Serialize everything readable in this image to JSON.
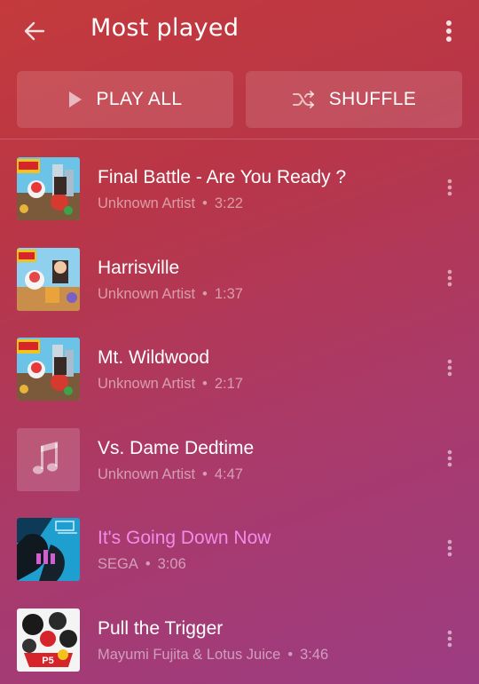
{
  "header": {
    "title": "Most played",
    "back_icon": "arrow-left-icon",
    "more_icon": "more-vertical-icon"
  },
  "actions": {
    "play_all_label": "PLAY ALL",
    "shuffle_label": "SHUFFLE"
  },
  "colors": {
    "playing_title": "#f08ce8",
    "gradient_top": "#c43a3c",
    "gradient_bottom": "#9c3c82"
  },
  "songs": [
    {
      "title": "Final Battle - Are You Ready ?",
      "artist": "Unknown Artist",
      "duration": "3:22",
      "art": "yokai-cover"
    },
    {
      "title": "Harrisville",
      "artist": "Unknown Artist",
      "duration": "1:37",
      "art": "yokai-cover-2"
    },
    {
      "title": "Mt. Wildwood",
      "artist": "Unknown Artist",
      "duration": "2:17",
      "art": "yokai-cover"
    },
    {
      "title": "Vs. Dame Dedtime",
      "artist": "Unknown Artist",
      "duration": "4:47",
      "art": "music-note-placeholder"
    },
    {
      "title": "It's Going Down Now",
      "artist": "SEGA",
      "duration": "3:06",
      "art": "persona3-cover",
      "playing": true
    },
    {
      "title": "Pull the Trigger",
      "artist": "Mayumi Fujita & Lotus Juice",
      "duration": "3:46",
      "art": "persona5-cover"
    }
  ]
}
